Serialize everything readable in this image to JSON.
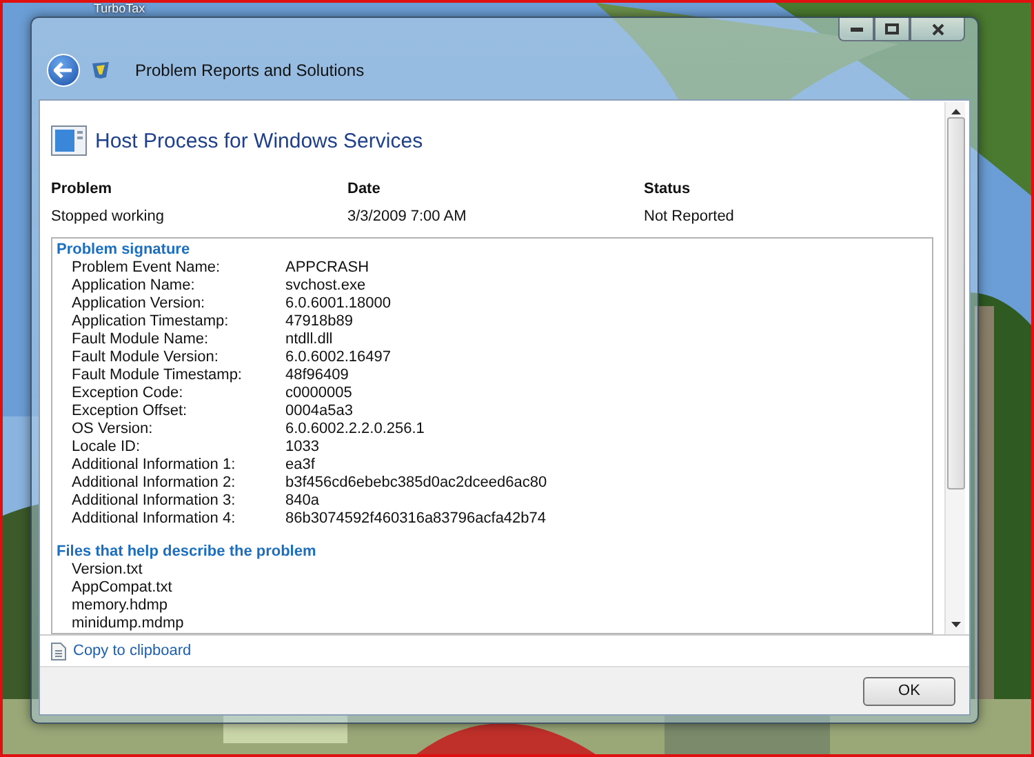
{
  "desktop": {
    "icon_label": "TurboTax"
  },
  "window": {
    "nav_title": "Problem Reports and Solutions",
    "heading": "Host Process for Windows Services",
    "summary": {
      "columns": [
        "Problem",
        "Date",
        "Status"
      ],
      "values": [
        "Stopped working",
        "3/3/2009 7:00 AM",
        "Not Reported"
      ]
    },
    "signature": {
      "title": "Problem signature",
      "rows": [
        {
          "label": "Problem Event Name:",
          "value": "APPCRASH"
        },
        {
          "label": "Application Name:",
          "value": "svchost.exe"
        },
        {
          "label": "Application Version:",
          "value": "6.0.6001.18000"
        },
        {
          "label": "Application Timestamp:",
          "value": "47918b89"
        },
        {
          "label": "Fault Module Name:",
          "value": "ntdll.dll"
        },
        {
          "label": "Fault Module Version:",
          "value": "6.0.6002.16497"
        },
        {
          "label": "Fault Module Timestamp:",
          "value": "48f96409"
        },
        {
          "label": "Exception Code:",
          "value": "c0000005"
        },
        {
          "label": "Exception Offset:",
          "value": "0004a5a3"
        },
        {
          "label": "OS Version:",
          "value": "6.0.6002.2.2.0.256.1"
        },
        {
          "label": "Locale ID:",
          "value": "1033"
        },
        {
          "label": "Additional Information 1:",
          "value": "ea3f"
        },
        {
          "label": "Additional Information 2:",
          "value": "b3f456cd6ebebc385d0ac2dceed6ac80"
        },
        {
          "label": "Additional Information 3:",
          "value": "840a"
        },
        {
          "label": "Additional Information 4:",
          "value": "86b3074592f460316a83796acfa42b74"
        }
      ]
    },
    "files": {
      "title": "Files that help describe the problem",
      "items": [
        "Version.txt",
        "AppCompat.txt",
        "memory.hdmp",
        "minidump.mdmp"
      ]
    },
    "copy_link": "Copy to clipboard",
    "buttons": [
      "OK"
    ]
  }
}
